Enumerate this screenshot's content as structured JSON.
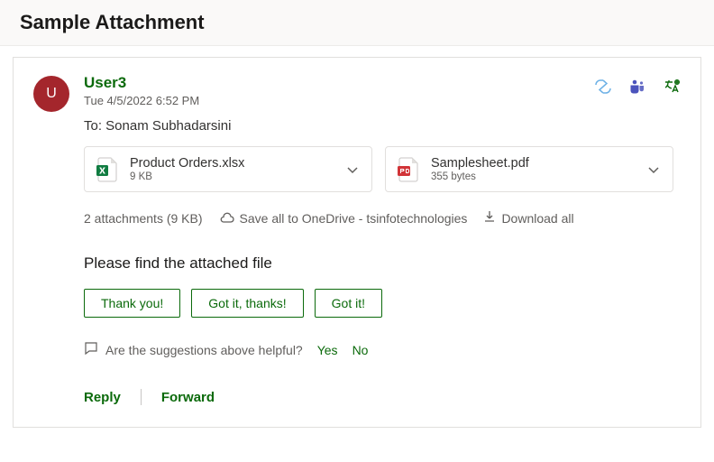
{
  "header": {
    "title": "Sample Attachment"
  },
  "sender": {
    "name": "User3",
    "initial": "U",
    "timestamp": "Tue 4/5/2022 6:52 PM"
  },
  "to_line": "To: Sonam Subhadarsini",
  "attachments": [
    {
      "name": "Product Orders.xlsx",
      "size": "9 KB"
    },
    {
      "name": "Samplesheet.pdf",
      "size": "355 bytes"
    }
  ],
  "attachment_summary": {
    "count_text": "2 attachments (9 KB)",
    "save_all_label": "Save all to OneDrive - tsinfotechnologies",
    "download_all_label": "Download all"
  },
  "body_text": "Please find  the attached file",
  "quick_replies": [
    "Thank you!",
    "Got it, thanks!",
    "Got it!"
  ],
  "feedback": {
    "prompt": "Are the suggestions above helpful?",
    "yes": "Yes",
    "no": "No"
  },
  "actions": {
    "reply": "Reply",
    "forward": "Forward"
  }
}
